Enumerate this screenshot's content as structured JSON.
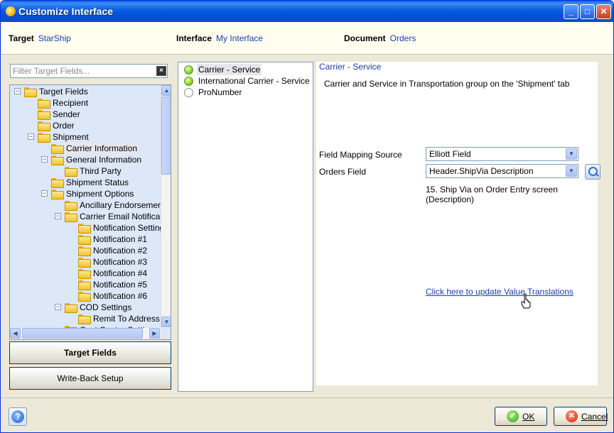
{
  "window": {
    "title": "Customize Interface"
  },
  "header": {
    "target_label": "Target",
    "target_value": "StarShip",
    "interface_label": "Interface",
    "interface_value": "My Interface",
    "document_label": "Document",
    "document_value": "Orders"
  },
  "filter": {
    "placeholder": "Filter Target Fields..."
  },
  "tree": {
    "nodes": [
      {
        "label": "Target Fields",
        "expanded": true
      },
      {
        "label": "Recipient"
      },
      {
        "label": "Sender"
      },
      {
        "label": "Order"
      },
      {
        "label": "Shipment",
        "expanded": true
      },
      {
        "label": "Carrier Information",
        "selected": true
      },
      {
        "label": "General Information",
        "expanded": true
      },
      {
        "label": "Third Party"
      },
      {
        "label": "Shipment Status"
      },
      {
        "label": "Shipment Options",
        "expanded": true
      },
      {
        "label": "Ancillary Endorsement"
      },
      {
        "label": "Carrier Email Notificatio",
        "expanded": true
      },
      {
        "label": "Notification Setting"
      },
      {
        "label": "Notification #1"
      },
      {
        "label": "Notification #2"
      },
      {
        "label": "Notification #3"
      },
      {
        "label": "Notification #4"
      },
      {
        "label": "Notification #5"
      },
      {
        "label": "Notification #6"
      },
      {
        "label": "COD Settings",
        "expanded": true
      },
      {
        "label": "Remit To Address"
      },
      {
        "label": "Cost Center Settings"
      }
    ]
  },
  "nav_buttons": {
    "target_fields": "Target Fields",
    "write_back": "Write-Back Setup"
  },
  "field_list": [
    {
      "label": "Carrier - Service",
      "status": "mapped",
      "selected": true
    },
    {
      "label": "International Carrier - Service",
      "status": "mapped"
    },
    {
      "label": "ProNumber",
      "status": "unmapped"
    }
  ],
  "detail": {
    "title": "Carrier - Service",
    "description": "Carrier and Service in Transportation group on the 'Shipment' tab",
    "mapping_source_label": "Field Mapping Source",
    "mapping_source_value": "Elliott Field",
    "orders_field_label": "Orders Field",
    "orders_field_value": "Header.ShipVia Description",
    "orders_field_note": "15. Ship Via on Order Entry screen (Description)",
    "translation_link": "Click here to update Value Translations"
  },
  "footer": {
    "help": "?",
    "ok": "OK",
    "cancel": "Cancel"
  },
  "colors": {
    "title_bar": "#0a5be0",
    "link": "#1a3fa8",
    "tree_bg": "#dce7f7"
  },
  "icons": {
    "title": "app-icon",
    "filter_clear": "close-icon",
    "folder": "folder-icon",
    "lookup": "magnifier-icon"
  }
}
